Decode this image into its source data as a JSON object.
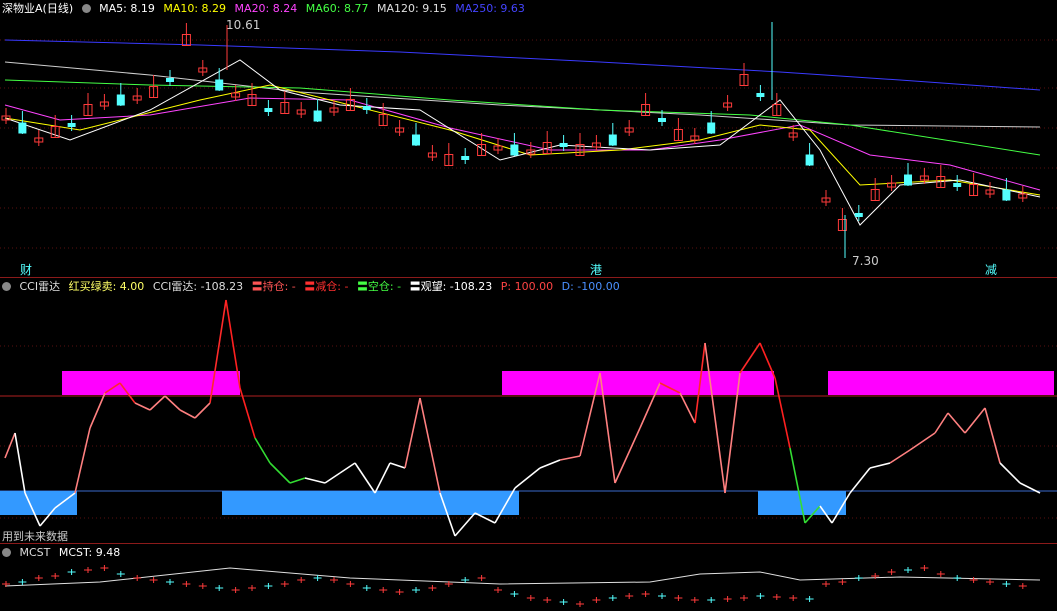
{
  "main": {
    "title": "深物业A(日线)",
    "ma": [
      {
        "label": "MA5: 8.19",
        "color": "#ffffff"
      },
      {
        "label": "MA10: 8.29",
        "color": "#ffff00"
      },
      {
        "label": "MA20: 8.24",
        "color": "#ff44ff"
      },
      {
        "label": "MA60: 8.77",
        "color": "#44ff44"
      },
      {
        "label": "MA120: 9.15",
        "color": "#e0e0e0"
      },
      {
        "label": "MA250: 9.63",
        "color": "#3a3aff"
      }
    ],
    "high_label": "10.61",
    "low_label": "7.30",
    "events": [
      "财",
      "港",
      "减"
    ]
  },
  "cci": {
    "name": "CCI雷达",
    "params": [
      {
        "label": "红买绿卖: 4.00",
        "color": "#ffff66"
      },
      {
        "label": "CCI雷达: -108.23",
        "color": "#dddddd"
      },
      {
        "label": "〓持仓: -",
        "color": "#ff5555"
      },
      {
        "label": "〓减仓: -",
        "color": "#ff3030"
      },
      {
        "label": "〓空仓: -",
        "color": "#44ff44"
      },
      {
        "label": "〓观望: -108.23",
        "color": "#ffffff"
      },
      {
        "label": "P: 100.00",
        "color": "#ff4444"
      },
      {
        "label": "D: -100.00",
        "color": "#4a90ff"
      }
    ],
    "note": "用到未来数据",
    "colors": {
      "upper_band": "#ff00ff",
      "lower_band": "#3399ff"
    }
  },
  "mcst": {
    "name": "MCST",
    "value": "MCST: 9.48"
  },
  "colors": {
    "up": "#ff3b3b",
    "down": "#54ffff",
    "bg": "#000000"
  }
}
